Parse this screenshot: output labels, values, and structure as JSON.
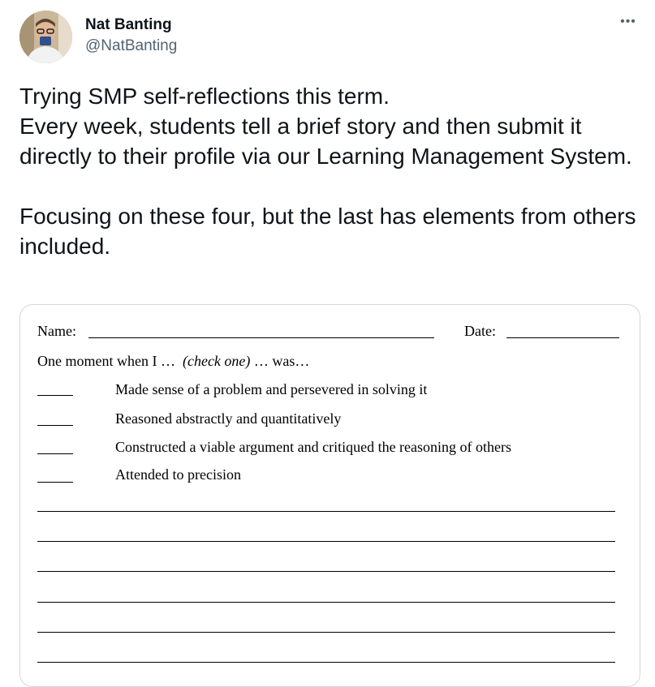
{
  "tweet": {
    "author_name": "Nat Banting",
    "author_handle": "@NatBanting",
    "more_icon": "more-horizontal-icon",
    "text_paragraphs": [
      "Trying SMP self-reflections this term.",
      "Every week, students tell a brief story and then submit it directly to their profile via our Learning Management System.",
      "",
      "Focusing on these four, but the last has elements from others included."
    ]
  },
  "worksheet": {
    "name_label": "Name:",
    "date_label": "Date:",
    "prompt_prefix": "One moment when I …",
    "prompt_italic": "(check one)",
    "prompt_suffix": "… was…",
    "options": [
      "Made sense of a problem and persevered in solving it",
      "Reasoned abstractly and quantitatively",
      "Constructed a viable argument and critiqued the reasoning of others",
      "Attended to precision"
    ]
  },
  "colors": {
    "text": "#0f1419",
    "secondary": "#536471",
    "border": "#cfd9de"
  }
}
